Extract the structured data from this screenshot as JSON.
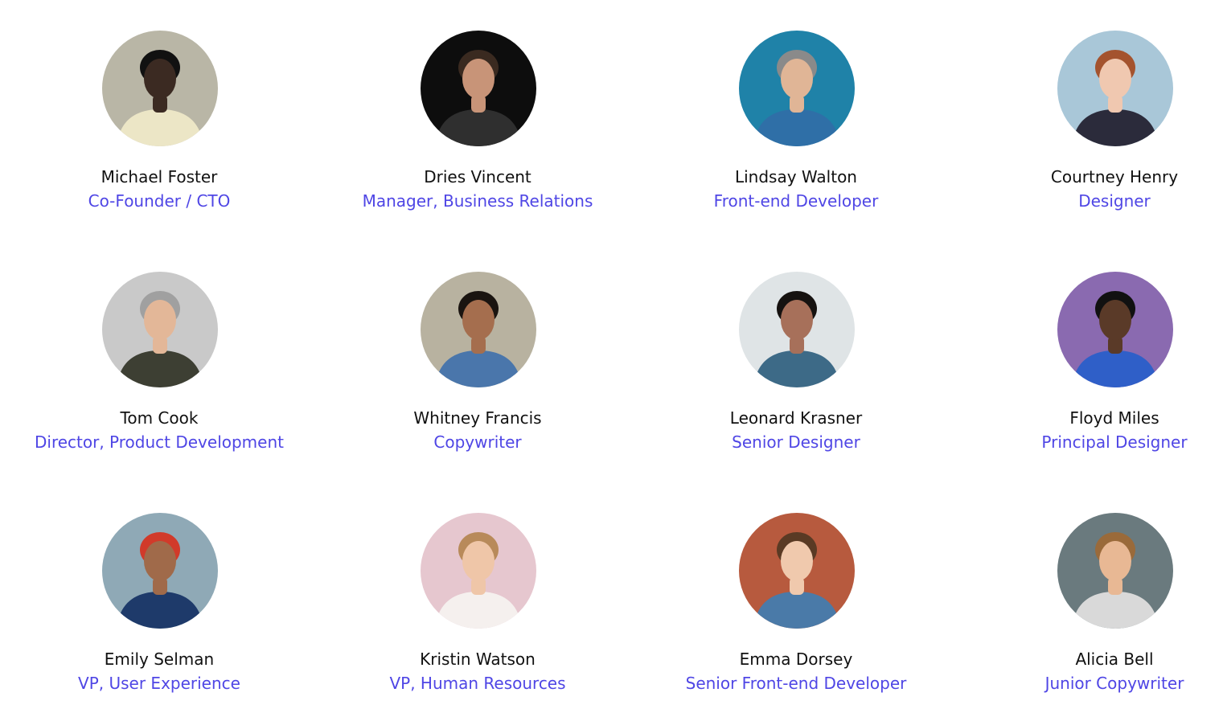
{
  "team": {
    "accent_color": "#4f46e5",
    "members": [
      {
        "name": "Michael Foster",
        "role": "Co-Founder / CTO",
        "bg": "#b9b6a6",
        "skin": "#3b2a22",
        "hair": "#111111",
        "shirt": "#ece6c6"
      },
      {
        "name": "Dries Vincent",
        "role": "Manager, Business Relations",
        "bg": "#0d0d0d",
        "skin": "#c89478",
        "hair": "#3a2a20",
        "shirt": "#2f2f2f"
      },
      {
        "name": "Lindsay Walton",
        "role": "Front-end Developer",
        "bg": "#1f82a8",
        "skin": "#e0b596",
        "hair": "#8a8a8a",
        "shirt": "#2f6fa7"
      },
      {
        "name": "Courtney Henry",
        "role": "Designer",
        "bg": "#a9c7d8",
        "skin": "#f0c8b0",
        "hair": "#a4532e",
        "shirt": "#2b2b3b"
      },
      {
        "name": "Tom Cook",
        "role": "Director, Product Development",
        "bg": "#c9c9c9",
        "skin": "#e3b798",
        "hair": "#a0a0a0",
        "shirt": "#3d3f33"
      },
      {
        "name": "Whitney Francis",
        "role": "Copywriter",
        "bg": "#b8b2a0",
        "skin": "#a56e4e",
        "hair": "#1a1410",
        "shirt": "#4a76ab"
      },
      {
        "name": "Leonard Krasner",
        "role": "Senior Designer",
        "bg": "#dfe4e6",
        "skin": "#a7705a",
        "hair": "#161210",
        "shirt": "#3d6a87"
      },
      {
        "name": "Floyd Miles",
        "role": "Principal Designer",
        "bg": "#8a6ab0",
        "skin": "#5a3a28",
        "hair": "#111111",
        "shirt": "#2f5fc8"
      },
      {
        "name": "Emily Selman",
        "role": "VP, User Experience",
        "bg": "#8fa9b6",
        "skin": "#a06a4a",
        "hair": "#d13a2a",
        "shirt": "#1e3a6a"
      },
      {
        "name": "Kristin Watson",
        "role": "VP, Human Resources",
        "bg": "#e6c7cf",
        "skin": "#efc6a8",
        "hair": "#b88a5a",
        "shirt": "#f5f0ee"
      },
      {
        "name": "Emma Dorsey",
        "role": "Senior Front-end Developer",
        "bg": "#b75a3e",
        "skin": "#f0c9ad",
        "hair": "#5a3a24",
        "shirt": "#4a7aa8"
      },
      {
        "name": "Alicia Bell",
        "role": "Junior Copywriter",
        "bg": "#6a7a7e",
        "skin": "#e8b894",
        "hair": "#9a6a3a",
        "shirt": "#d9d9d9"
      }
    ]
  }
}
